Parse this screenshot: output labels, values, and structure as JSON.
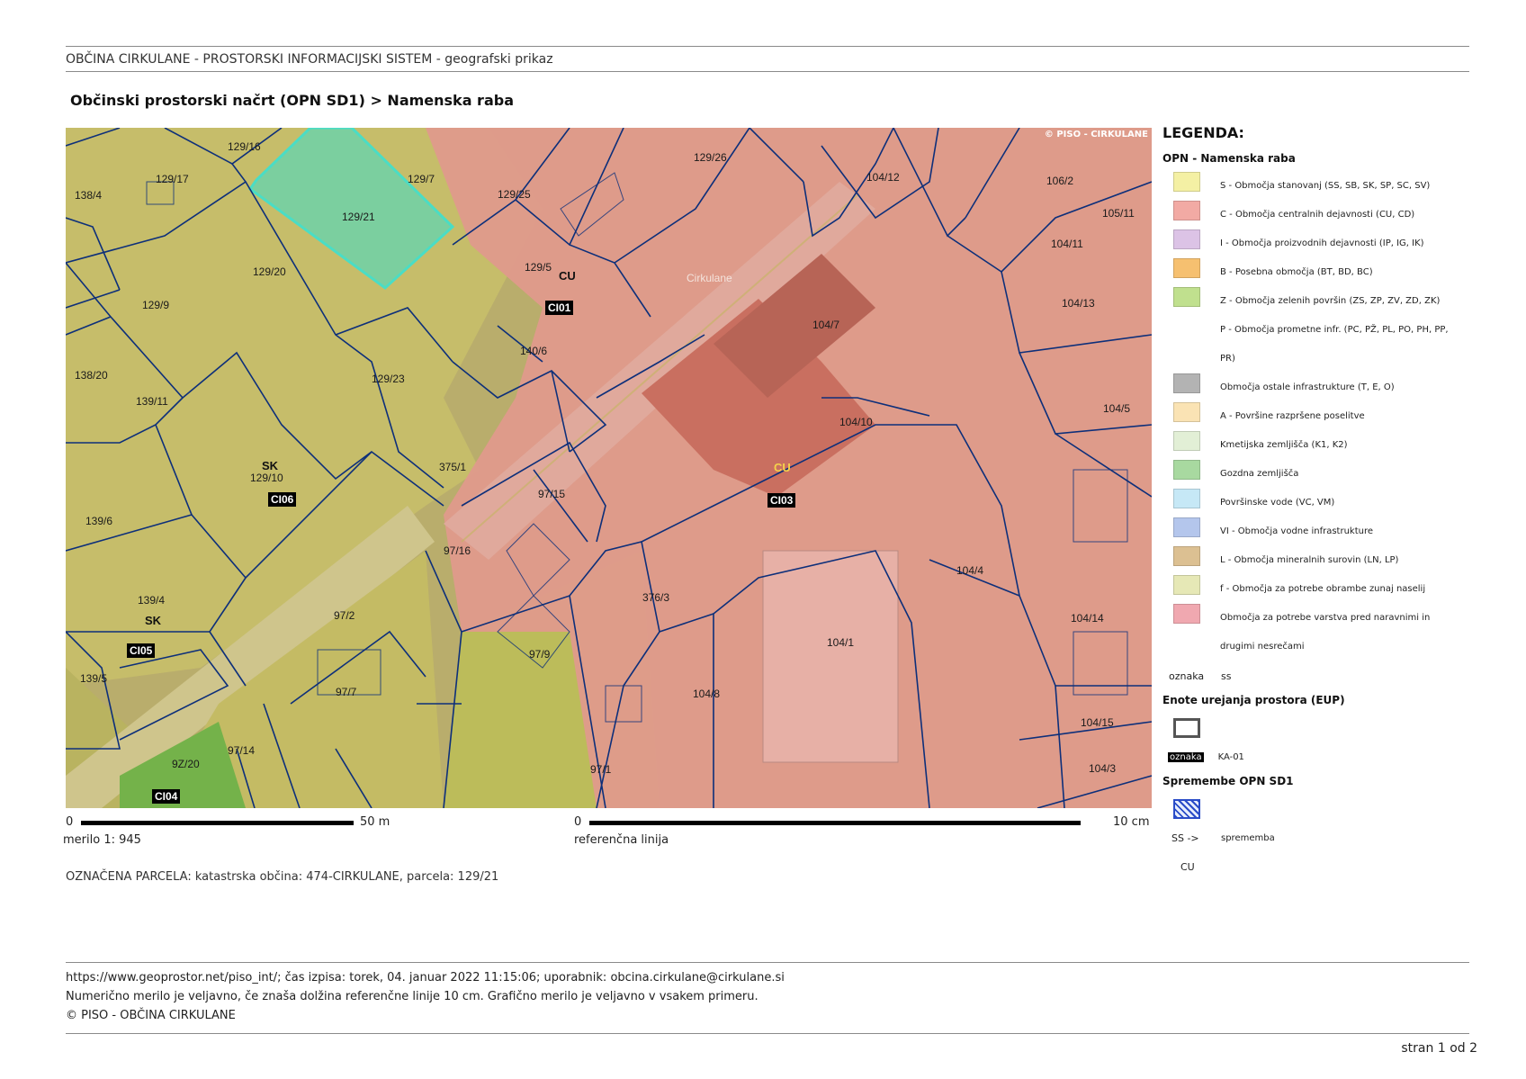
{
  "header": {
    "system_title": "OBČINA CIRKULANE - PROSTORSKI INFORMACIJSKI SISTEM - geografski prikaz",
    "map_title": "Občinski prostorski načrt (OPN SD1) > Namenska raba"
  },
  "map": {
    "copyright": "© PISO - CIRKULANE",
    "place_name": "Cirkulane",
    "parcels": [
      "129/16",
      "129/17",
      "138/4",
      "129/7",
      "129/21",
      "129/25",
      "129/26",
      "104/12",
      "106/2",
      "105/11",
      "104/11",
      "129/20",
      "129/5",
      "129/9",
      "140/6",
      "104/7",
      "104/13",
      "138/20",
      "129/23",
      "139/11",
      "104/10",
      "104/5",
      "375/1",
      "129/10",
      "97/15",
      "139/6",
      "97/16",
      "104/4",
      "139/4",
      "97/2",
      "376/3",
      "104/14",
      "104/1",
      "97/9",
      "139/5",
      "97/7",
      "104/8",
      "104/15",
      "97/14",
      "9Z/20",
      "97/1",
      "104/3"
    ],
    "zones": [
      "CU",
      "CU",
      "SK",
      "SK"
    ],
    "eup_labels": [
      "CI01",
      "CI06",
      "CI03",
      "CI05",
      "CI04"
    ],
    "colors": {
      "residential": "#c9c06a",
      "central": "#e39a8e",
      "forest": "#6fae4a",
      "selected_outline": "#35e3d6",
      "parcel_line": "#0d2f7a"
    }
  },
  "scale": {
    "zero1": "0",
    "bar_label1": "50 m",
    "merilo": "merilo 1: 945",
    "zero2": "0",
    "bar_label2": "10 cm",
    "ref": "referenčna linija"
  },
  "selected": "OZNAČENA PARCELA: katastrska občina: 474-CIRKULANE, parcela: 129/21",
  "legend": {
    "title": "LEGENDA:",
    "section1": "OPN - Namenska raba",
    "items": [
      {
        "color": "#f4f0a4",
        "label": "S - Območja stanovanj (SS, SB, SK, SP, SC, SV)"
      },
      {
        "color": "#f2aaa4",
        "label": "C - Območja centralnih dejavnosti (CU, CD)"
      },
      {
        "color": "#dcc3e6",
        "label": "I - Območja proizvodnih dejavnosti (IP, IG, IK)"
      },
      {
        "color": "#f6c070",
        "label": "B - Posebna območja (BT, BD, BC)"
      },
      {
        "color": "#c0e08e",
        "label": "Z - Območja zelenih površin (ZS, ZP, ZV, ZD, ZK)"
      },
      {
        "color": "",
        "label": "P - Območja prometne infr. (PC, PŽ, PL, PO, PH, PP,",
        "label2": "PR)"
      },
      {
        "color": "#b3b3b3",
        "label": "Območja ostale infrastrukture (T, E, O)"
      },
      {
        "color": "#fae3b4",
        "label": "A - Površine razpršene poselitve"
      },
      {
        "color": "#e2efd6",
        "label": "Kmetijska zemljišča (K1, K2)"
      },
      {
        "color": "#a8d9a0",
        "label": "Gozdna zemljišča"
      },
      {
        "color": "#c6e8f6",
        "label": "Površinske vode (VC, VM)"
      },
      {
        "color": "#b4c6ec",
        "label": "VI - Območja vodne infrastrukture"
      },
      {
        "color": "#dcc092",
        "label": "L - Območja mineralnih surovin (LN, LP)"
      },
      {
        "color": "#e6e8b6",
        "label": "f - Območja za potrebe obrambe zunaj naselij"
      },
      {
        "color": "#f0a8b0",
        "label": "Območja za potrebe varstva pred naravnimi in",
        "label2": "drugimi nesrečami"
      }
    ],
    "oznaka": "oznaka",
    "oznaka_val": "ss",
    "section2": "Enote urejanja prostora (EUP)",
    "eup_tag": "oznaka",
    "eup_val": "KA-01",
    "section3": "Spremembe OPN SD1",
    "ss_arrow": "SS ->",
    "sprememba": "sprememba",
    "cu": "CU"
  },
  "footer": {
    "line1": "https://www.geoprostor.net/piso_int/; čas izpisa: torek, 04. januar 2022 11:15:06; uporabnik: obcina.cirkulane@cirkulane.si",
    "line2": "Numerično merilo je veljavno, če znaša dolžina referenčne linije 10 cm. Grafično merilo je veljavno v vsakem primeru.",
    "line3": "© PISO - OBČINA CIRKULANE",
    "page": "stran 1 od 2"
  }
}
